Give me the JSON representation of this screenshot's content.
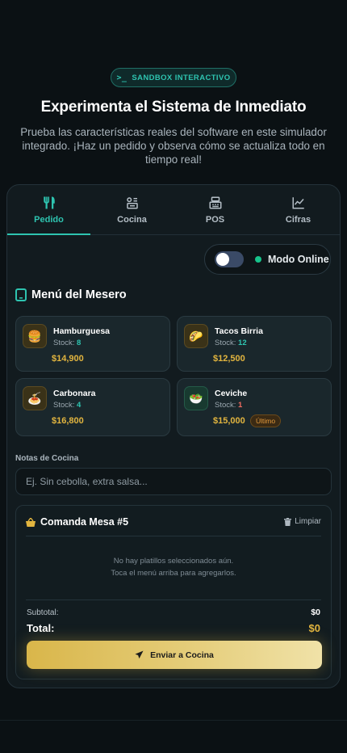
{
  "badge": {
    "icon": "terminal-icon",
    "label": "SANDBOX INTERACTIVO"
  },
  "hero": {
    "title": "Experimenta el Sistema de Inmediato",
    "subtitle": "Prueba las características reales del software en este simulador integrado. ¡Haz un pedido y observa cómo se actualiza todo en tiempo real!"
  },
  "tabs": [
    {
      "label": "Pedido",
      "icon": "utensils-icon",
      "active": true
    },
    {
      "label": "Cocina",
      "icon": "chef-icon",
      "active": false
    },
    {
      "label": "POS",
      "icon": "register-icon",
      "active": false
    },
    {
      "label": "Cifras",
      "icon": "chart-line-icon",
      "active": false
    }
  ],
  "mode": {
    "label": "Modo Online",
    "enabled": false,
    "status_color": "#17c38b"
  },
  "menu": {
    "title": "Menú del Mesero",
    "stock_label": "Stock:",
    "items": [
      {
        "name": "Hamburguesa",
        "stock": "8",
        "price": "$14,900",
        "emoji": "🍔",
        "tag": ""
      },
      {
        "name": "Tacos Birria",
        "stock": "12",
        "price": "$12,500",
        "emoji": "🌮",
        "tag": ""
      },
      {
        "name": "Carbonara",
        "stock": "4",
        "price": "$16,800",
        "emoji": "🍝",
        "tag": ""
      },
      {
        "name": "Ceviche",
        "stock": "1",
        "price": "$15,000",
        "emoji": "🥗",
        "tag": "Último"
      }
    ]
  },
  "notes": {
    "label": "Notas de Cocina",
    "placeholder": "Ej. Sin cebolla, extra salsa...",
    "value": ""
  },
  "order": {
    "title": "Comanda Mesa #5",
    "clear_label": "Limpiar",
    "empty_line1": "No hay platillos seleccionados aún.",
    "empty_line2": "Toca el menú arriba para agregarlos.",
    "subtotal_label": "Subtotal:",
    "subtotal_value": "$0",
    "total_label": "Total:",
    "total_value": "$0",
    "send_label": "Enviar a Cocina"
  },
  "colors": {
    "accent": "#2ec4b0",
    "gold": "#e2b53f",
    "background": "#0b1114"
  }
}
